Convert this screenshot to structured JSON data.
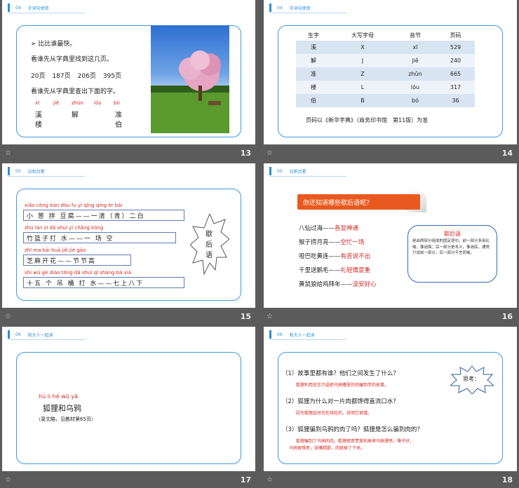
{
  "slides": [
    {
      "number": "13",
      "section": "04",
      "section_title": "字词句使用",
      "bullet": "➢ 比比谁最快。",
      "line1": "看谁先从字典里找到这几页。",
      "pages": [
        "20页",
        "187页",
        "206页",
        "395页"
      ],
      "line2": "看谁先从字典里查出下面的字。",
      "chars": [
        {
          "pinyin": "xī",
          "char": "溪"
        },
        {
          "pinyin": "jiě",
          "char": "解"
        },
        {
          "pinyin": "zhǔn",
          "char": "准"
        },
        {
          "pinyin": "lóu",
          "char": "楼"
        },
        {
          "pinyin": "bó",
          "char": "伯"
        }
      ]
    },
    {
      "number": "14",
      "section": "04",
      "section_title": "字词句使用",
      "headers": [
        "生字",
        "大写字母",
        "音节",
        "页码"
      ],
      "rows": [
        [
          "溪",
          "X",
          "xī",
          "529"
        ],
        [
          "解",
          "J",
          "jiě",
          "240"
        ],
        [
          "准",
          "Z",
          "zhǔn",
          "665"
        ],
        [
          "楼",
          "L",
          "lóu",
          "317"
        ],
        [
          "伯",
          "B",
          "bó",
          "36"
        ]
      ],
      "note": "页码以《新华字典》（商务印书馆　第11版）为准"
    },
    {
      "number": "15",
      "section": "05",
      "section_title": "日积月累",
      "items": [
        {
          "pinyin": "xiǎo cōng bàn dòu fu    yì qīng qīng  èr bái",
          "text": "小 葱 拌 豆腐——一清（青）二白"
        },
        {
          "pinyin": "zhú lán zi dǎ shuǐ    yì chǎng kōng",
          "text": "竹篮子打 水——一 场 空"
        },
        {
          "pinyin": "zhī ma kāi huā jié jié gāo",
          "text": "芝麻开花——节节高"
        },
        {
          "pinyin": "shí wǔ gè diào tǒng dǎ shuǐ qī shàng bā xià",
          "text": "十五 个 吊 桶 打 水——七上八下"
        }
      ],
      "badge": [
        "歇",
        "后",
        "语"
      ]
    },
    {
      "number": "16",
      "section": "05",
      "section_title": "日积月累",
      "tab_label": "你还知道哪些歇后语呢？",
      "lines": [
        {
          "left": "八仙过海——",
          "right": "各显神通"
        },
        {
          "left": "猴子捞月亮——",
          "right": "空忙一场"
        },
        {
          "left": "哑巴吃黄连——",
          "right": "有苦说不出"
        },
        {
          "left": "千里送鹅毛——",
          "right": "礼轻情意重"
        },
        {
          "left": "黄鼠狼给鸡拜年——",
          "right": "没安好心"
        }
      ],
      "bubble_title": "歇后语",
      "bubble_text": "是由两部分组成的固定语句，前一部分多用比喻，像谜面；后一部分是本义，像谜底，通常只说前一部分，后一部分不言而喻。"
    },
    {
      "number": "17",
      "section": "06",
      "section_title": "和大人一起读",
      "pinyin": "hú  li  hé  wū  yā",
      "title": "狐狸和乌鸦",
      "subtitle": "（录文略，见教材第65页）"
    },
    {
      "number": "18",
      "section": "06",
      "section_title": "和大人一起读",
      "burst_label": "思考：",
      "qa": [
        {
          "q": "（1）故事里都有谁？他们之间发生了什么？",
          "a": "狐狸利用花言巧语把乌鸦嘴里的肉骗到手的故事。"
        },
        {
          "q": "（2）狐狸为什么对一片肉都馋得直流口水？",
          "a": "因为狐狸此时也在找吃的，说明它很饿。"
        },
        {
          "q": "（3）狐狸骗到乌鸦的肉了吗？狐狸是怎么骗到肉的？",
          "a": "狐狸骗到了乌鸦的肉。狐狸假意赞美和奉承乌鸦漂亮，嗓子好，",
          "a2": "乌鸦很得意，张嘴唱歌，肉就掉了下来。"
        }
      ]
    }
  ],
  "colors": {
    "accent": "#2a8fd6",
    "red": "#d7261f",
    "orange": "#e9591f"
  }
}
